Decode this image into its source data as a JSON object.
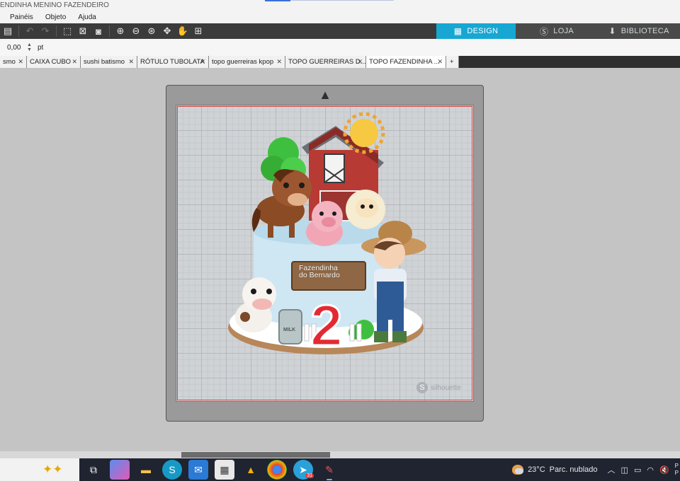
{
  "window": {
    "title": "ENDINHA MENINO FAZENDEIRO"
  },
  "menu": {
    "items": [
      "Painéis",
      "Objeto",
      "Ajuda"
    ]
  },
  "main_tabs": {
    "design": "DESIGN",
    "loja": "LOJA",
    "biblioteca": "BIBLIOTECA"
  },
  "properties": {
    "value": "0,00",
    "unit": "pt"
  },
  "doc_tabs": [
    {
      "label": "smo"
    },
    {
      "label": "CAIXA CUBO"
    },
    {
      "label": "sushi batismo"
    },
    {
      "label": "RÓTULO TUBOLATA"
    },
    {
      "label": "topo guerreiras kpop"
    },
    {
      "label": "TOPO GUERREIRAS D..."
    },
    {
      "label": "TOPO FAZENDINHA ..."
    }
  ],
  "doc_tab_add": "+",
  "design": {
    "plaque_line1": "Fazendinha",
    "plaque_line2": "do Bernardo",
    "number": "2",
    "milk_label": "MILK",
    "watermark": "silhouette"
  },
  "taskbar": {
    "temperature": "23°C",
    "weather": "Parc. nublado",
    "telegram_badge": "31",
    "clock_line1": "P",
    "clock_line2": "P"
  },
  "colors": {
    "accent": "#17a7d2",
    "toolbar": "#3b3b3b",
    "cutline": "#d94a4a"
  }
}
